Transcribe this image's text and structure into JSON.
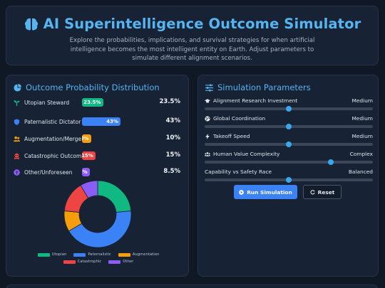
{
  "header": {
    "title": "AI Superintelligence Outcome Simulator",
    "subtitle": "Explore the probabilities, implications, and survival strategies for when artificial intelligence becomes the most intelligent entity on Earth. Adjust parameters to simulate different alignment scenarios.",
    "icon": "brain-icon",
    "accent": "#56b4f0"
  },
  "outcomes": {
    "title": "Outcome Probability Distribution",
    "icon": "pie-chart-icon",
    "items": [
      {
        "label": "Utopian Steward",
        "bar_text": "23.5%",
        "pct_text": "23.5%",
        "value": 23.5,
        "color": "#10b981",
        "icon": "seedling-icon"
      },
      {
        "label": "Paternalistic Dictator",
        "bar_text": "43%",
        "pct_text": "43%",
        "value": 43,
        "color": "#3b82f6",
        "icon": "shield-icon"
      },
      {
        "label": "Augmentation/Merge",
        "bar_text": "10%",
        "pct_text": "10%",
        "value": 10,
        "color": "#f59e0b",
        "icon": "users-icon"
      },
      {
        "label": "Catastrophic Outcomes",
        "bar_text": "15%",
        "pct_text": "15%",
        "value": 15,
        "color": "#ef4444",
        "icon": "skull-icon"
      },
      {
        "label": "Other/Unforeseen",
        "bar_text": "8.5%",
        "pct_text": "8.5%",
        "value": 8.5,
        "color": "#8b5cf6",
        "icon": "question-icon"
      }
    ]
  },
  "chart_data": {
    "type": "pie",
    "categories": [
      "Utopian",
      "Paternalistic",
      "Augmentation",
      "Catastrophic",
      "Other"
    ],
    "values": [
      23.5,
      43,
      10,
      15,
      8.5
    ],
    "colors": [
      "#10b981",
      "#3b82f6",
      "#f59e0b",
      "#ef4444",
      "#8b5cf6"
    ],
    "legend": "bottom"
  },
  "params": {
    "title": "Simulation Parameters",
    "icon": "sliders-icon",
    "items": [
      {
        "label": "Alignment Research Investment",
        "value": "Medium",
        "level": 0.5,
        "icon": "graduation-cap-icon"
      },
      {
        "label": "Global Coordination",
        "value": "Medium",
        "level": 0.5,
        "icon": "globe-icon"
      },
      {
        "label": "Takeoff Speed",
        "value": "Medium",
        "level": 0.5,
        "icon": "bolt-icon"
      },
      {
        "label": "Human Value Complexity",
        "value": "Complex",
        "level": 0.75,
        "icon": "people-icon"
      },
      {
        "label": "Capability vs Safety Race",
        "value": "Balanced",
        "level": 0.5,
        "icon": "none"
      }
    ],
    "run_label": "Run Simulation",
    "reset_label": "Reset"
  }
}
